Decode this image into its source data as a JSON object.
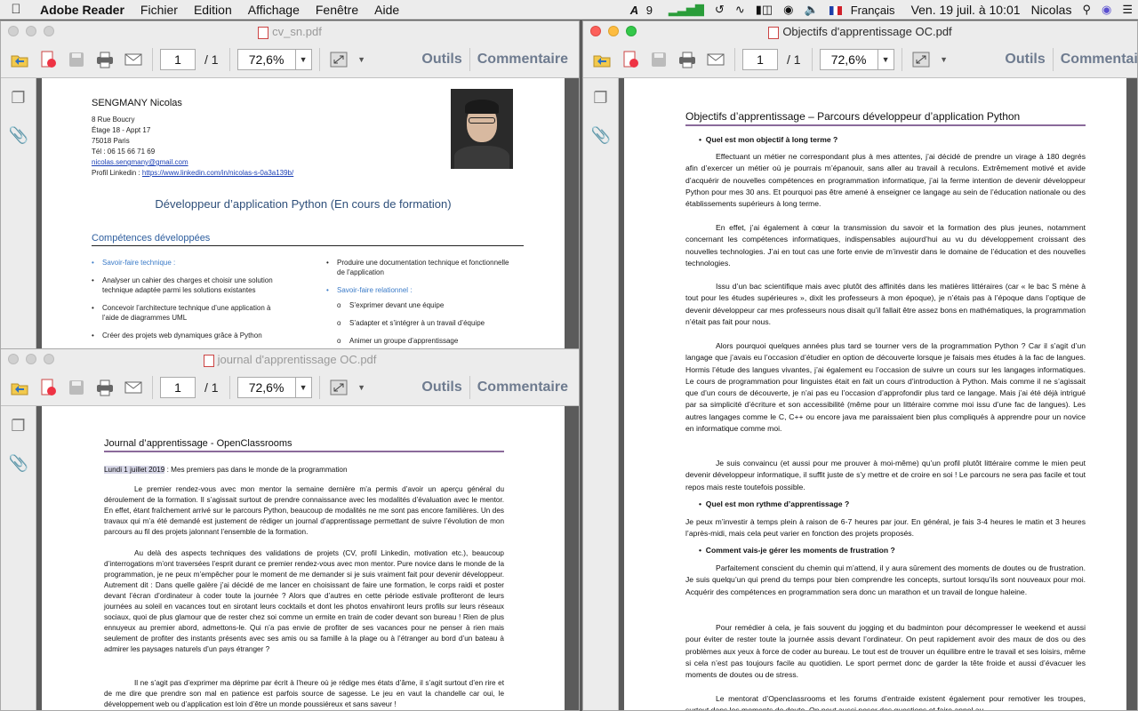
{
  "menubar": {
    "app": "Adobe Reader",
    "items": [
      "Fichier",
      "Edition",
      "Affichage",
      "Fenêtre",
      "Aide"
    ],
    "status": {
      "adobe_badge": "9",
      "language": "Français",
      "datetime": "Ven. 19 juil. à 10:01",
      "user": "Nicolas"
    }
  },
  "toolbar_common": {
    "page_current": "1",
    "page_total": "/ 1",
    "zoom": "72,6%",
    "tools": "Outils",
    "comment": "Commentaire"
  },
  "windows": {
    "cv": {
      "title": "cv_sn.pdf"
    },
    "journal": {
      "title": "journal d'apprentissage OC.pdf"
    },
    "objectifs": {
      "title": "Objectifs d'apprentissage OC.pdf"
    }
  },
  "cv": {
    "name": "SENGMANY Nicolas",
    "address1": "8 Rue Boucry",
    "address2": "Étage 18 - Appt 17",
    "address3": "75018 Paris",
    "phone": "Tél : 06 15 66 71 69",
    "email": "nicolas.sengmany@gmail.com",
    "linkedin_label": "Profil Linkedin : ",
    "linkedin_url": "https://www.linkedin.com/in/nicolas-s-0a3a139b/",
    "title": "Développeur d’application Python  (En cours de formation)",
    "section": "Compétences développées",
    "col1_head": "Savoir-faire technique :",
    "col1_items": [
      "Analyser un cahier des charges et choisir une solution technique adaptée parmi les solutions existantes",
      "Concevoir l’architecture technique d’une application à l’aide de diagrammes UML",
      "Créer des projets web dynamiques grâce à Python"
    ],
    "col2_items": [
      "Produire une documentation technique et fonctionnelle de l’application"
    ],
    "col2_head": "Savoir-faire relationnel :",
    "col2_sub": [
      "S’exprimer devant une équipe",
      "S’adapter et s’intégrer à un travail d’équipe",
      "Animer un groupe d’apprentissage"
    ]
  },
  "journal": {
    "heading": "Journal d’apprentissage - OpenClassrooms",
    "date": "Lundi 1 juillet 2019",
    "date_rest": " : Mes premiers pas dans le monde de la programmation",
    "p1": "Le premier rendez-vous avec mon mentor la semaine dernière m’a permis d’avoir un aperçu général du déroulement de la formation. Il s’agissait surtout de prendre connaissance avec les modalités d’évaluation avec le mentor. En effet, étant fraîchement arrivé sur le parcours Python, beaucoup de modalités ne me sont pas encore familières. Un des travaux qui m’a été demandé est justement de rédiger un journal d’apprentissage permettant de suivre l’évolution de mon parcours au fil des projets jalonnant l’ensemble de la formation.",
    "p2": "Au delà des aspects techniques des validations de projets (CV, profil Linkedin, motivation etc.), beaucoup d’interrogations m’ont traversées l’esprit durant ce premier rendez-vous avec mon mentor. Pure novice dans le monde de la programmation, je ne peux m’empêcher pour le moment de me demander si je suis vraiment fait pour devenir développeur. Autrement dit : Dans quelle galère j’ai décidé de me lancer en choisissant de faire une formation, le corps raidi et poster devant l’écran d’ordinateur à coder toute la journée ? Alors que d’autres en cette période estivale profiteront de leurs journées au soleil en vacances tout en sirotant leurs cocktails et dont les photos envahiront leurs profils sur leurs réseaux sociaux, quoi de plus glamour que de rester chez soi comme un ermite en train de coder devant son bureau ! Rien de plus ennuyeux au premier abord, admettons-le. Qui n’a pas envie de profiter de ses vacances pour ne penser à rien mais seulement de profiter des instants présents avec ses amis ou sa famille à la plage ou à l’étranger au bord d’un bateau à admirer les paysages naturels d’un pays étranger ?",
    "p3": "Il ne s’agit pas d’exprimer ma déprime par écrit à l’heure où je rédige mes états d’âme, il s’agit surtout d’en rire et de me dire que prendre son mal en patience est parfois source de sagesse. Le jeu en vaut la chandelle car oui, le développement web ou d’application est loin d’être un monde poussiéreux et sans saveur !"
  },
  "objectifs": {
    "heading": "Objectifs d’apprentissage – Parcours développeur d’application Python",
    "q1": "Quel est mon objectif à long terme ?",
    "p1": "Effectuant un métier ne correspondant plus à mes attentes, j’ai décidé de prendre un virage à 180 degrés afin d’exercer un métier où je pourrais m’épanouir, sans aller au travail à reculons. Extrêmement motivé et avide d’acquérir de nouvelles compétences en programmation informatique, j’ai la ferme intention de devenir développeur Python pour mes 30 ans. Et pourquoi pas être amené à enseigner ce langage au sein de l’éducation nationale ou des établissements supérieurs à long terme.",
    "p2": "En effet, j’ai également à cœur la transmission du savoir et la formation des plus jeunes, notamment concernant les compétences informatiques, indispensables aujourd’hui au vu du développement croissant des nouvelles technologies.  J’ai en tout cas une forte envie de m’investir dans le domaine de l’éducation et des nouvelles technologies.",
    "p3": "Issu d’un bac scientifique mais avec plutôt des affinités dans les matières littéraires (car « le bac S mène à tout pour les études supérieures », dixit les professeurs à mon époque), je n’étais pas à l’époque dans l’optique de devenir développeur car mes professeurs nous disait qu’il fallait être assez bons en mathématiques, la programmation n’était pas fait pour nous.",
    "p4": "Alors pourquoi quelques années plus tard se tourner vers de la programmation Python ? Car il s’agit d’un langage que j’avais eu l’occasion d’étudier en option de découverte lorsque je faisais mes études à la fac de langues. Hormis l’étude des langues vivantes, j’ai également eu l’occasion de suivre un cours sur les langages informatiques. Le cours de programmation pour linguistes était en fait un cours d’introduction à Python. Mais comme il ne s’agissait que d’un cours de découverte, je n’ai pas eu l’occasion d’approfondir plus tard ce langage. Mais j’ai été déjà intrigué par sa simplicité d’écriture et son accessibilité (même pour un littéraire comme moi issu d’une fac de langues). Les autres langages comme le C, C++ ou encore java me paraissaient bien plus compliqués à apprendre pour un novice en informatique comme moi.",
    "p5": "Je suis convaincu (et aussi pour me prouver à moi-même) qu’un profil plutôt littéraire comme le mien peut devenir développeur informatique, il suffit juste de s’y mettre et de croire en soi ! Le parcours ne sera pas facile et tout repos mais reste toutefois possible.",
    "q2": "Quel est mon rythme d’apprentissage ?",
    "p6": "Je peux m’investir à temps plein à raison de 6-7 heures par jour. En général, je fais 3-4 heures le matin et 3 heures l’après-midi, mais cela peut varier en fonction des projets proposés.",
    "q3": "Comment vais-je gérer les moments de frustration ?",
    "p7": "Parfaitement conscient du chemin qui m’attend, il y aura sûrement des moments de doutes ou de frustration. Je suis quelqu’un qui prend du temps pour bien comprendre les concepts, surtout lorsqu’ils sont nouveaux pour moi. Acquérir des compétences en programmation sera donc un marathon et un travail de longue haleine.",
    "p8": "Pour remédier à cela, je fais souvent du jogging et du badminton pour décompresser le weekend et aussi pour éviter de rester toute la journée assis devant l’ordinateur. On peut rapidement avoir des maux de dos ou des problèmes aux yeux à force de coder au bureau. Le tout est de trouver un équilibre entre le travail et ses loisirs, même si cela n’est pas toujours facile au quotidien. Le sport permet donc de garder la tête froide et aussi d’évacuer les moments de doutes ou de stress.",
    "p9": "Le mentorat d’Openclassrooms et les forums d’entraide existent également pour remotiver les troupes, surtout dans les moments de doute. On peut aussi poser des questions et faire appel au"
  }
}
